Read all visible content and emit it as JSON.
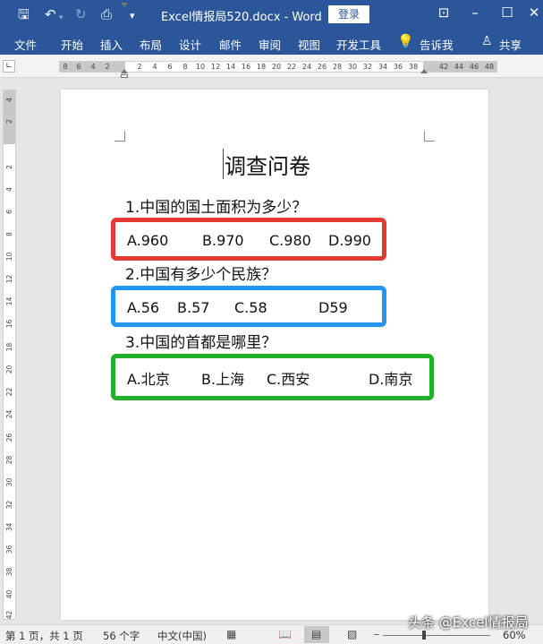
{
  "titlebar": {
    "doc_title": "Excel情报局520.docx  -  Word",
    "login_label": "登录",
    "qa_icons": [
      "save-icon",
      "undo-icon",
      "redo-icon",
      "print-preview-icon",
      "customize-icon"
    ],
    "window_icons": [
      "ribbon-display-icon",
      "minimize-icon",
      "maximize-icon",
      "close-icon"
    ]
  },
  "ribbon": {
    "tabs": [
      "文件",
      "开始",
      "插入",
      "布局",
      "设计",
      "邮件",
      "审阅",
      "视图",
      "开发工具"
    ],
    "tell_me": "告诉我",
    "share": "共享"
  },
  "ruler": {
    "horizontal_labels": [
      "8",
      "6",
      "4",
      "2",
      "2",
      "4",
      "6",
      "8",
      "10",
      "12",
      "14",
      "16",
      "18",
      "20",
      "22",
      "24",
      "26",
      "28",
      "30",
      "32",
      "34",
      "36",
      "38",
      "42",
      "44",
      "46",
      "48"
    ],
    "vertical_labels": [
      "4",
      "2",
      "2",
      "4",
      "6",
      "8",
      "10",
      "12",
      "14",
      "16",
      "18",
      "20",
      "22",
      "24",
      "26",
      "28",
      "30",
      "32",
      "34",
      "36",
      "38",
      "40",
      "42"
    ]
  },
  "document": {
    "heading": "调查问卷",
    "questions": [
      {
        "text": "1.中国的国土面积为多少？",
        "box_color": "#e53935",
        "options": [
          "A.960",
          "B.970",
          "C.980",
          "D.990"
        ]
      },
      {
        "text": "2.中国有多少个民族？",
        "box_color": "#2196f3",
        "options": [
          "A.56",
          "B.57",
          "C.58",
          "D59"
        ]
      },
      {
        "text": "3.中国的首都是哪里？",
        "box_color": "#22b02b",
        "options": [
          "A.北京",
          "B.上海",
          "C.西安",
          "D.南京"
        ]
      }
    ]
  },
  "statusbar": {
    "page": "第 1 页，共 1 页",
    "words": "56 个字",
    "language": "中文(中国)",
    "zoom": "60%"
  },
  "watermark": "头条 @Excel情报局"
}
